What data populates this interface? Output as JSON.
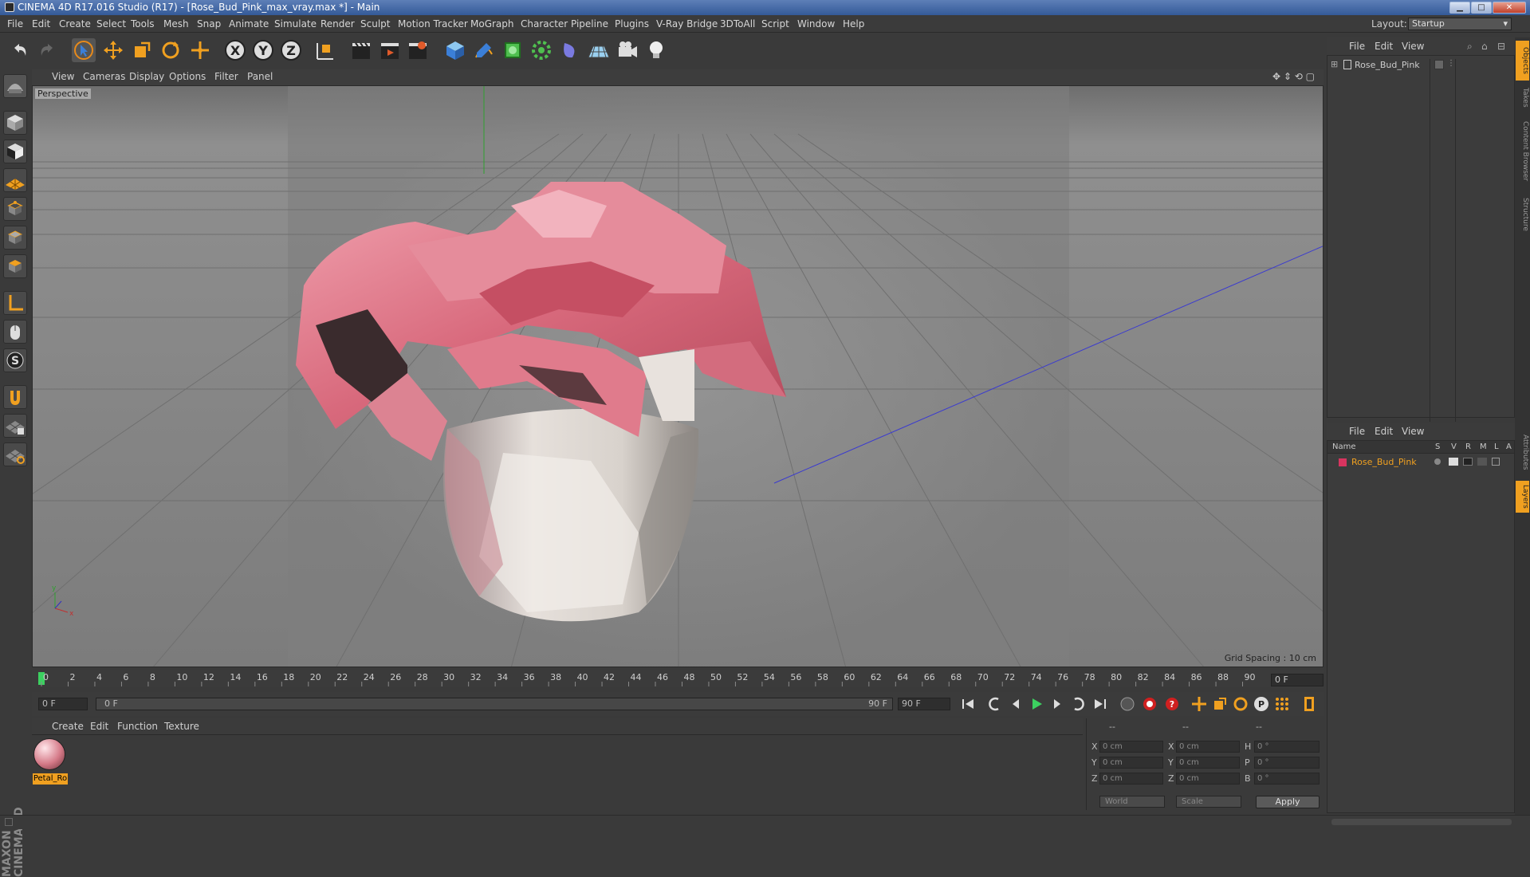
{
  "window": {
    "title": "CINEMA 4D R17.016 Studio (R17) - [Rose_Bud_Pink_max_vray.max *] - Main",
    "min": "▁",
    "max": "□",
    "close": "✕"
  },
  "menu": [
    "File",
    "Edit",
    "Create",
    "Select",
    "Tools",
    "Mesh",
    "Snap",
    "Animate",
    "Simulate",
    "Render",
    "Sculpt",
    "Motion Tracker",
    "MoGraph",
    "Character",
    "Pipeline",
    "Plugins",
    "V-Ray Bridge",
    "3DToAll",
    "Script",
    "Window",
    "Help"
  ],
  "layout": {
    "label": "Layout:",
    "value": "Startup"
  },
  "viewport": {
    "menu": [
      "View",
      "Cameras",
      "Display",
      "Options",
      "Filter",
      "Panel"
    ],
    "label": "Perspective",
    "grid_spacing": "Grid Spacing : 10 cm",
    "axis_y": "y",
    "axis_x": "x"
  },
  "timeline": {
    "ticks": [
      "0",
      "2",
      "4",
      "6",
      "8",
      "10",
      "12",
      "14",
      "16",
      "18",
      "20",
      "22",
      "24",
      "26",
      "28",
      "30",
      "32",
      "34",
      "36",
      "38",
      "40",
      "42",
      "44",
      "46",
      "48",
      "50",
      "52",
      "54",
      "56",
      "58",
      "60",
      "62",
      "64",
      "66",
      "68",
      "70",
      "72",
      "74",
      "76",
      "78",
      "80",
      "82",
      "84",
      "86",
      "88",
      "90"
    ],
    "current_frame": "0 F",
    "start_frame": "0 F",
    "range_start": "0 F",
    "range_end": "90 F",
    "end_frame": "90 F"
  },
  "materials": {
    "menu": [
      "Create",
      "Edit",
      "Function",
      "Texture"
    ],
    "items": [
      {
        "name": "Petal_Ro"
      }
    ]
  },
  "coords": {
    "headers": [
      "--",
      "--",
      "--"
    ],
    "rows": [
      {
        "a": "X",
        "av": "0 cm",
        "b": "X",
        "bv": "0 cm",
        "c": "H",
        "cv": "0 °"
      },
      {
        "a": "Y",
        "av": "0 cm",
        "b": "Y",
        "bv": "0 cm",
        "c": "P",
        "cv": "0 °"
      },
      {
        "a": "Z",
        "av": "0 cm",
        "b": "Z",
        "bv": "0 cm",
        "c": "B",
        "cv": "0 °"
      }
    ],
    "mode1": "World",
    "mode2": "Scale",
    "apply": "Apply"
  },
  "object_manager": {
    "menu": [
      "File",
      "Edit",
      "View"
    ],
    "objects": [
      {
        "name": "Rose_Bud_Pink"
      }
    ]
  },
  "layer_manager": {
    "menu": [
      "File",
      "Edit",
      "View"
    ],
    "columns": [
      "Name",
      "S",
      "V",
      "R",
      "M",
      "L",
      "A"
    ],
    "layers": [
      {
        "name": "Rose_Bud_Pink",
        "color": "#d8345f"
      }
    ]
  },
  "side_tabs": [
    "Objects",
    "Takes",
    "Content Browser",
    "Structure",
    "Attributes",
    "Layers"
  ],
  "colors": {
    "accent": "#f0a020",
    "viewport_bg": "#8a8a8a",
    "petal": "#e07b8c"
  }
}
